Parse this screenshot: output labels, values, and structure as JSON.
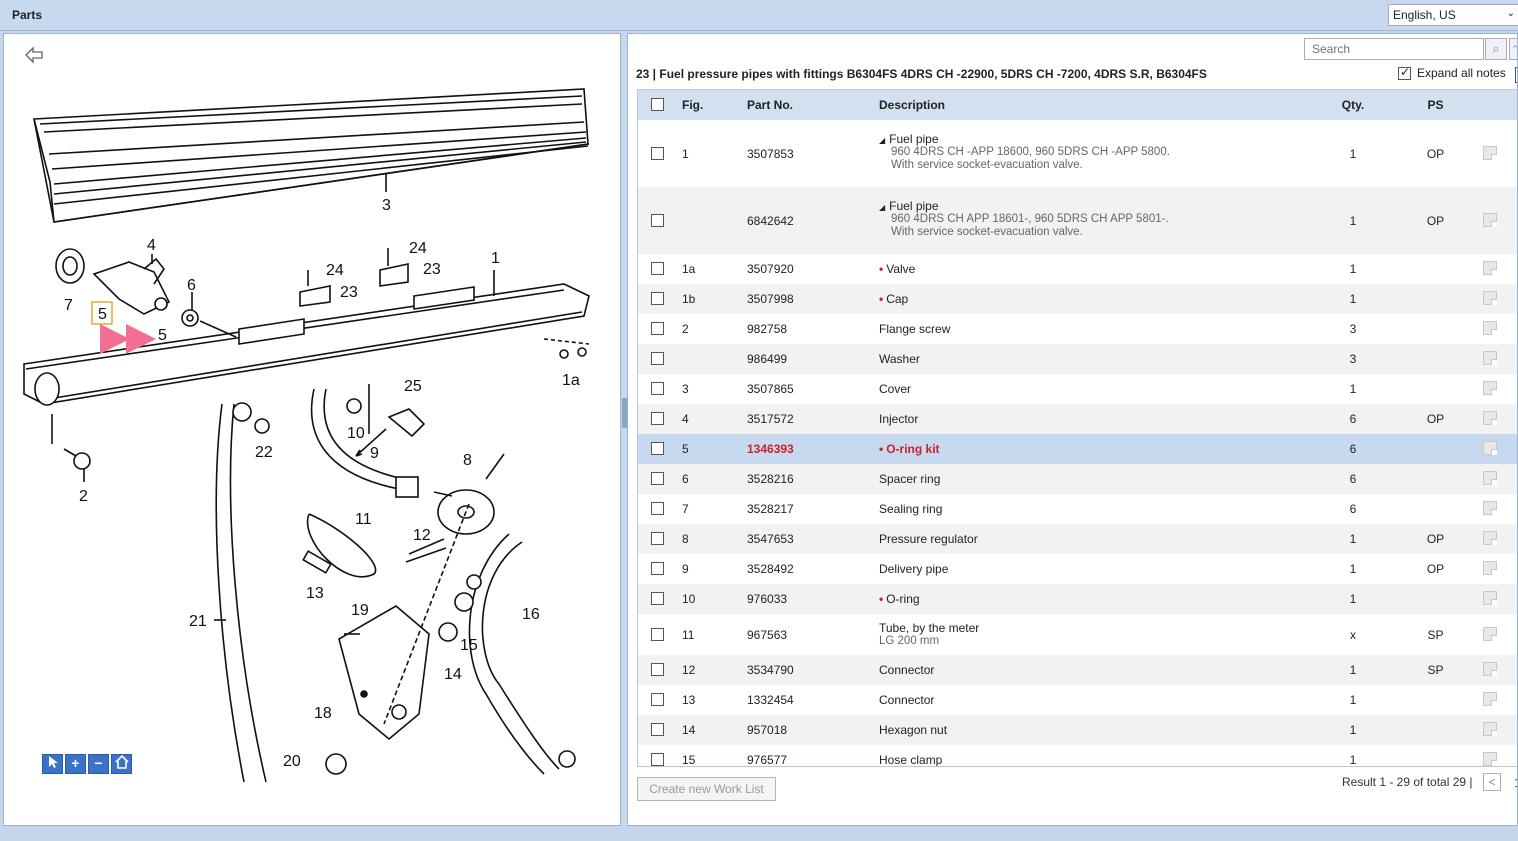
{
  "app": {
    "title": "Parts"
  },
  "language": {
    "selected": "English, US"
  },
  "search": {
    "placeholder": "Search"
  },
  "heading": {
    "text": "23  |  Fuel pressure pipes with fittings B6304FS 4DRS CH -22900, 5DRS CH -7200, 4DRS S.R, B6304FS"
  },
  "expand_all": {
    "label": "Expand all notes",
    "checked": true
  },
  "columns": {
    "fig": "Fig.",
    "part": "Part No.",
    "desc": "Description",
    "qty": "Qty.",
    "ps": "PS"
  },
  "rows": [
    {
      "fig": "1",
      "part": "3507853",
      "title": "Fuel pipe",
      "expandable": true,
      "sub1": "960 4DRS CH -APP 18600, 960 5DRS CH -APP 5800.",
      "sub2": "With service socket-evacuation valve.",
      "qty": "1",
      "ps": "OP"
    },
    {
      "fig": "",
      "part": "6842642",
      "title": "Fuel pipe",
      "expandable": true,
      "sub1": "960 4DRS CH APP 18601-, 960 5DRS CH APP 5801-.",
      "sub2": "With service socket-evacuation valve.",
      "qty": "1",
      "ps": "OP"
    },
    {
      "fig": "1a",
      "part": "3507920",
      "title": "Valve",
      "bullet": true,
      "qty": "1",
      "ps": ""
    },
    {
      "fig": "1b",
      "part": "3507998",
      "title": "Cap",
      "bullet": true,
      "qty": "1",
      "ps": ""
    },
    {
      "fig": "2",
      "part": "982758",
      "title": "Flange screw",
      "qty": "3",
      "ps": ""
    },
    {
      "fig": "",
      "part": "986499",
      "title": "Washer",
      "qty": "3",
      "ps": ""
    },
    {
      "fig": "3",
      "part": "3507865",
      "title": "Cover",
      "qty": "1",
      "ps": ""
    },
    {
      "fig": "4",
      "part": "3517572",
      "title": "Injector",
      "qty": "6",
      "ps": "OP"
    },
    {
      "fig": "5",
      "part": "1346393",
      "title": "O-ring kit",
      "bullet": true,
      "selected": true,
      "qty": "6",
      "ps": ""
    },
    {
      "fig": "6",
      "part": "3528216",
      "title": "Spacer ring",
      "qty": "6",
      "ps": ""
    },
    {
      "fig": "7",
      "part": "3528217",
      "title": "Sealing ring",
      "qty": "6",
      "ps": ""
    },
    {
      "fig": "8",
      "part": "3547653",
      "title": "Pressure regulator",
      "qty": "1",
      "ps": "OP"
    },
    {
      "fig": "9",
      "part": "3528492",
      "title": "Delivery pipe",
      "qty": "1",
      "ps": "OP"
    },
    {
      "fig": "10",
      "part": "976033",
      "title": "O-ring",
      "bullet": true,
      "qty": "1",
      "ps": ""
    },
    {
      "fig": "11",
      "part": "967563",
      "title": "Tube, by the meter",
      "sub1": "LG 200 mm",
      "qty": "x",
      "ps": "SP"
    },
    {
      "fig": "12",
      "part": "3534790",
      "title": "Connector",
      "qty": "1",
      "ps": "SP"
    },
    {
      "fig": "13",
      "part": "1332454",
      "title": "Connector",
      "qty": "1",
      "ps": ""
    },
    {
      "fig": "14",
      "part": "957018",
      "title": "Hexagon nut",
      "qty": "1",
      "ps": ""
    },
    {
      "fig": "15",
      "part": "976577",
      "title": "Hose clamp",
      "qty": "1",
      "ps": ""
    }
  ],
  "footer": {
    "create_label": "Create new Work List",
    "result_text": "Result 1 - 29 of total 29  |",
    "pager_prev": "<",
    "pager_next": "1"
  },
  "diagram": {
    "callouts": [
      "1",
      "1a",
      "2",
      "3",
      "4",
      "5",
      "5",
      "6",
      "7",
      "8",
      "9",
      "10",
      "11",
      "12",
      "13",
      "14",
      "15",
      "16",
      "18",
      "19",
      "20",
      "21",
      "22",
      "23",
      "23",
      "24",
      "24",
      "25"
    ],
    "highlighted_callout": "5"
  },
  "colors": {
    "selected_row": "#c6d9ef",
    "accent_red": "#d0202a",
    "header_bg": "#d2e0ef",
    "marker_pink": "#f06f93"
  }
}
